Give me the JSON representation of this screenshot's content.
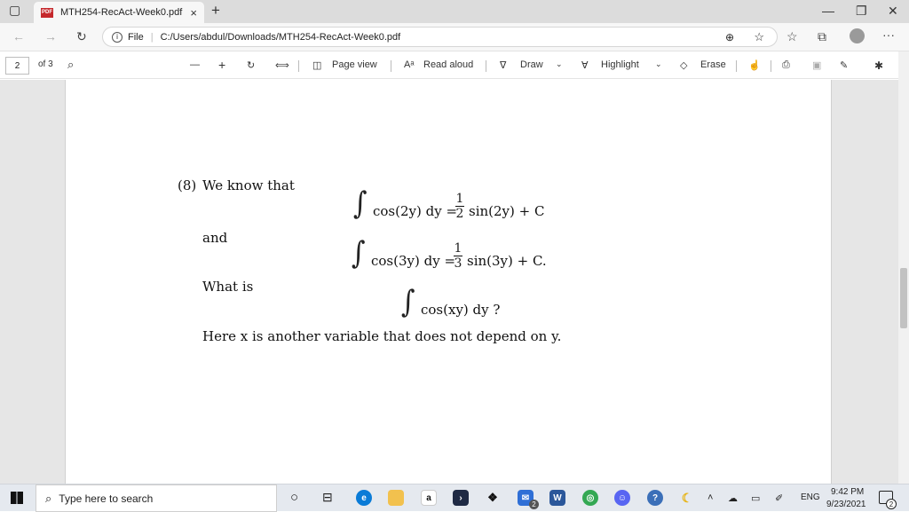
{
  "browser": {
    "tab_title": "MTH254-RecAct-Week0.pdf",
    "tab_close": "×",
    "new_tab": "+",
    "pdf_badge": "PDF",
    "address_prefix": "File",
    "url": "C:/Users/abdul/Downloads/MTH254-RecAct-Week0.pdf",
    "more": "···"
  },
  "pdf_toolbar": {
    "page_number": "2",
    "page_of": "of 3",
    "zoom_out": "—",
    "zoom_in": "+",
    "page_view": "Page view",
    "read_aloud": "Read aloud",
    "draw": "Draw",
    "highlight": "Highlight",
    "erase": "Erase"
  },
  "document": {
    "problem_number": "(8)",
    "intro": "We know that",
    "eq1_lhs": "cos(2y) dy =",
    "eq1_num": "1",
    "eq1_den": "2",
    "eq1_rhs": "sin(2y) + C",
    "and": "and",
    "eq2_lhs": "cos(3y) dy =",
    "eq2_num": "1",
    "eq2_den": "3",
    "eq2_rhs": "sin(3y) + C.",
    "what_is": "What is",
    "eq3": "cos(xy) dy ?",
    "note": "Here x is another variable that does not depend on y."
  },
  "taskbar": {
    "search_placeholder": "Type here to search",
    "lang": "ENG",
    "time": "9:42 PM",
    "date": "9/23/2021",
    "notif_count": "2",
    "mail_badge": "2"
  },
  "colors": {
    "edge_blue": "#0a7bd7",
    "pdf_red": "#c5282c",
    "word_blue": "#2b579a",
    "chrome_green": "#34a853",
    "discord": "#5865f2"
  }
}
